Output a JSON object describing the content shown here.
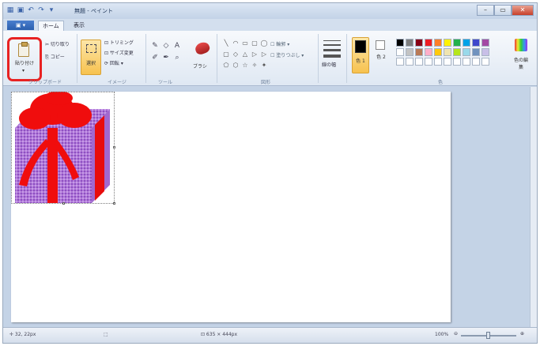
{
  "window": {
    "title": "無題 - ペイント",
    "qat_icons": [
      "paint-app-icon",
      "save-icon",
      "undo-icon",
      "redo-icon",
      "dropdown-icon"
    ],
    "controls": [
      "minimize",
      "maximize",
      "close"
    ]
  },
  "tabs": {
    "file_label": "▣ ▾",
    "items": [
      "ホーム",
      "表示"
    ],
    "active": "ホーム"
  },
  "ribbon": {
    "clipboard": {
      "paste_label": "貼り付け",
      "paste_arrow": "▾",
      "cut_label": "✂ 切り取り",
      "copy_label": "⎘ コピー",
      "group_label": "クリップボード"
    },
    "image": {
      "select_label": "選択",
      "crop_label": "⊡ トリミング",
      "resize_label": "⊡ サイズ変更",
      "rotate_label": "⟳ 回転 ▾",
      "group_label": "イメージ"
    },
    "tools": {
      "icons": [
        "✎",
        "◇",
        "A",
        "✐",
        "✒",
        "⌕"
      ],
      "group_label": "ツール"
    },
    "brush": {
      "label": "ブラシ"
    },
    "shapes": {
      "glyphs": [
        "╲",
        "◠",
        "▭",
        "▢",
        "◯",
        "▢",
        "◇",
        "△",
        "▷",
        "▷",
        "⬠",
        "⬡",
        "☆",
        "✧",
        "✦"
      ],
      "outline_label": "☐ 輪郭 ▾",
      "fill_label": "☐ 塗りつぶし ▾",
      "group_label": "図形"
    },
    "size": {
      "label": "線の幅"
    },
    "colors": {
      "color1_label": "色\n1",
      "color2_label": "色\n2",
      "palette": [
        "#000000",
        "#7f7f7f",
        "#880015",
        "#ed1c24",
        "#ff7f27",
        "#fff200",
        "#22b14c",
        "#00a2e8",
        "#3f48cc",
        "#a349a4",
        "#ffffff",
        "#c3c3c3",
        "#b97a57",
        "#ffaec9",
        "#ffc90e",
        "#efe4b0",
        "#b5e61d",
        "#99d9ea",
        "#7092be",
        "#c8bfe7",
        "#ffffff",
        "#ffffff",
        "#ffffff",
        "#ffffff",
        "#ffffff",
        "#ffffff",
        "#ffffff",
        "#ffffff",
        "#ffffff",
        "#ffffff"
      ],
      "edit_label": "色の編集",
      "group_label": "色"
    }
  },
  "canvas": {
    "drawing": "gift-box-with-red-ribbon"
  },
  "statusbar": {
    "position": "✛ 32, 22px",
    "selection_icon": "⬚",
    "size": "⊡ 635 × 444px",
    "zoom": "100%",
    "zoom_out": "⊖",
    "zoom_in": "⊕",
    "zoom_level": 0.5
  }
}
